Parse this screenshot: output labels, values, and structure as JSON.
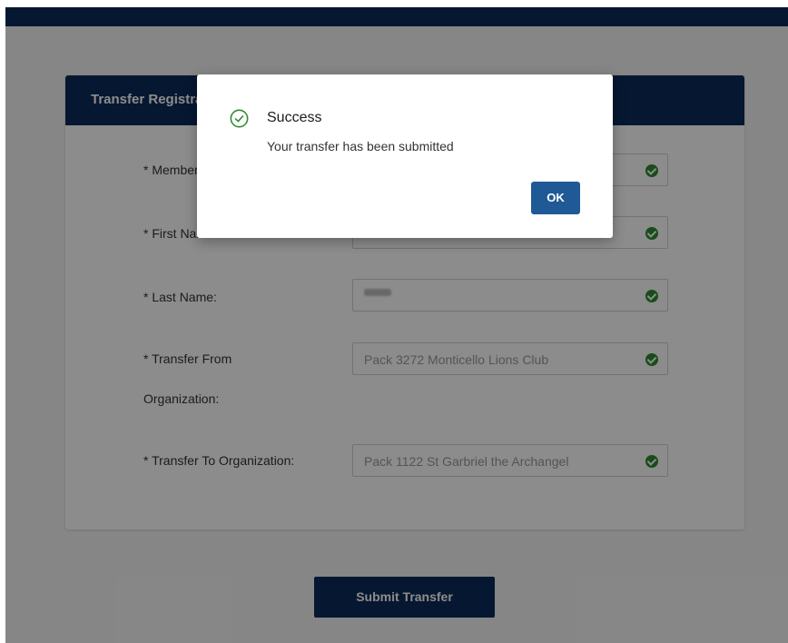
{
  "form": {
    "header_title": "Transfer Registration",
    "fields": [
      {
        "label": "* Member ID:",
        "value": ""
      },
      {
        "label": "* First Name:",
        "value": ""
      },
      {
        "label": "* Last Name:",
        "value": ""
      },
      {
        "label_line1": "* Transfer From",
        "label_line2": "Organization:",
        "value": "Pack 3272 Monticello Lions Club"
      },
      {
        "label": "* Transfer To Organization:",
        "value": "Pack 1122 St Garbriel the Archangel"
      }
    ],
    "submit_label": "Submit Transfer"
  },
  "dialog": {
    "title": "Success",
    "message": "Your transfer has been submitted",
    "ok_label": "OK"
  },
  "colors": {
    "brand_navy": "#0b2a5a",
    "success_green": "#2f8b2f",
    "ok_button_blue": "#1f5a96"
  }
}
